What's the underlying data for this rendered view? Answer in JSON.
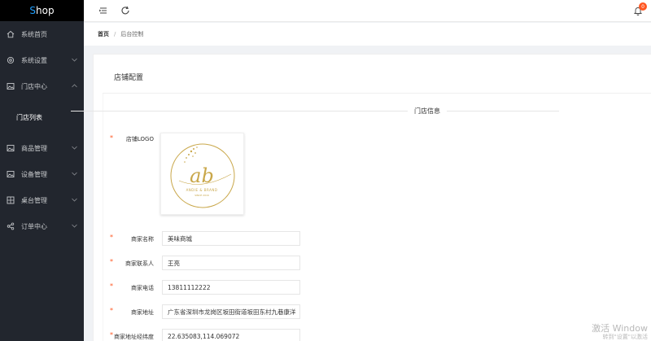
{
  "app": {
    "logo_first": "S",
    "logo_rest": "hop"
  },
  "sidebar": {
    "items": [
      {
        "label": "系统首页",
        "icon": "home-icon",
        "has_arrow": false
      },
      {
        "label": "系统设置",
        "icon": "settings-icon",
        "has_arrow": true
      },
      {
        "label": "门店中心",
        "icon": "image-icon",
        "has_arrow": true,
        "expanded": true
      },
      {
        "label": "商品管理",
        "icon": "image-icon",
        "has_arrow": true
      },
      {
        "label": "设备管理",
        "icon": "image-icon",
        "has_arrow": true
      },
      {
        "label": "桌台管理",
        "icon": "grid-icon",
        "has_arrow": true
      },
      {
        "label": "订单中心",
        "icon": "share-icon",
        "has_arrow": true
      }
    ],
    "subitems": [
      {
        "label": "门店列表"
      }
    ]
  },
  "topbar": {
    "notification_count": "0"
  },
  "breadcrumb": {
    "home": "首页",
    "separator": "/",
    "current": "后台控制"
  },
  "card": {
    "title": "店铺配置"
  },
  "form": {
    "section_title": "门店信息",
    "logo_label": "店铺LOGO",
    "logo_text": {
      "main": "ab",
      "sub1": "ANDIE & BRAND",
      "sub2": "SINCE 2016"
    },
    "fields": [
      {
        "label": "商家名称",
        "value": "美味商城"
      },
      {
        "label": "商家联系人",
        "value": "王亮"
      },
      {
        "label": "商家电话",
        "value": "13811112222"
      },
      {
        "label": "商家地址",
        "value": "广东省深圳市龙岗区坂田街道坂田东村九巷康洋"
      },
      {
        "label": "商家地址经纬度",
        "value": "22.635083,114.069072"
      }
    ],
    "required_mark": "*"
  },
  "watermark": {
    "line1": "激活 Window",
    "line2": "转到\"设置\"以激活"
  },
  "colors": {
    "sidebar_bg": "#22262e",
    "accent": "#1e9fff",
    "badge": "#ff5722",
    "required": "#ff5722",
    "logo_gold": "#c9a74a"
  }
}
